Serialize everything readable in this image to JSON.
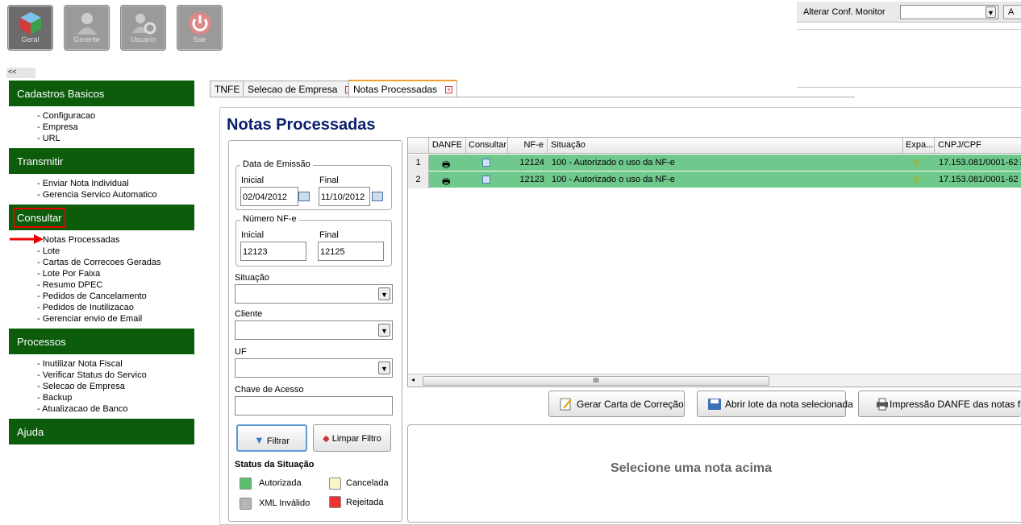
{
  "toolbar": {
    "buttons": [
      {
        "label": "Geral"
      },
      {
        "label": "Gerente"
      },
      {
        "label": "Usuário"
      },
      {
        "label": "Sair"
      }
    ]
  },
  "monitor": {
    "label": "Alterar Conf. Monitor",
    "select_value": "",
    "button_label": "A"
  },
  "sidebar": {
    "collapse_label": "<<",
    "sections": [
      {
        "title": "Cadastros Basicos",
        "items": [
          "- Configuracao",
          "- Empresa",
          "- URL"
        ]
      },
      {
        "title": "Transmitir",
        "items": [
          "- Enviar Nota Individual",
          "- Gerencia Servico Automatico"
        ]
      },
      {
        "title": "Consultar",
        "items": [
          "Notas Processadas",
          "- Lote",
          "- Cartas de Correcoes Geradas",
          "- Lote Por Faixa",
          "- Resumo DPEC",
          "- Pedidos de Cancelamento",
          "- Pedidos de Inutilizacao",
          "- Gerenciar envio de Email"
        ]
      },
      {
        "title": "Processos",
        "items": [
          "- Inutilizar Nota Fiscal",
          "- Verificar Status do Servico",
          "- Selecao de Empresa",
          "- Backup",
          "- Atualizacao de Banco"
        ]
      },
      {
        "title": "Ajuda",
        "items": []
      }
    ]
  },
  "tabs": [
    {
      "label": "TNFE"
    },
    {
      "label": "Selecao de Empresa"
    },
    {
      "label": "Notas Processadas"
    }
  ],
  "page_title": "Notas Processadas",
  "filter": {
    "date_legend": "Data de Emissão",
    "date_start_label": "Inicial",
    "date_start_value": "02/04/2012",
    "date_end_label": "Final",
    "date_end_value": "11/10/2012",
    "nfe_legend": "Número NF-e",
    "nfe_start_label": "Inicial",
    "nfe_start_value": "12123",
    "nfe_end_label": "Final",
    "nfe_end_value": "12125",
    "situacao_label": "Situação",
    "situacao_value": "",
    "cliente_label": "Cliente",
    "cliente_value": "",
    "uf_label": "UF",
    "uf_value": "",
    "chave_label": "Chave de Acesso",
    "chave_value": "",
    "filtrar_label": "Filtrar",
    "limpar_label": "Limpar Filtro",
    "status_title": "Status da Situação",
    "status": [
      {
        "label": "Autorizada",
        "color": "#5cbf6e"
      },
      {
        "label": "Cancelada",
        "color": "#fbf6c8"
      },
      {
        "label": "XML Inválido",
        "color": "#b5b5b5"
      },
      {
        "label": "Rejeitada",
        "color": "#e33"
      }
    ]
  },
  "grid": {
    "columns": [
      "DANFE",
      "Consultar",
      "NF-e",
      "Situação",
      "Expa...",
      "CNPJ/CPF"
    ],
    "rows": [
      {
        "num": "1",
        "nfe": "12124",
        "situacao": "100 - Autorizado o uso da NF-e",
        "cnpj": "17.153.081/0001-62"
      },
      {
        "num": "2",
        "nfe": "12123",
        "situacao": "100 - Autorizado o uso da NF-e",
        "cnpj": "17.153.081/0001-62"
      }
    ],
    "scroll_thumb": "III",
    "row_color": "#6fc98c"
  },
  "actions": {
    "carta_label": "Gerar Carta de Correção",
    "lote_label": "Abrir lote da nota selecionada",
    "danfe_label": "Impressão DANFE das notas filtr"
  },
  "detail_message": "Selecione uma nota acima",
  "colors": {
    "sidebar_section": "#0c5c0c",
    "title": "#0a1f6b",
    "highlight": "#e00"
  }
}
